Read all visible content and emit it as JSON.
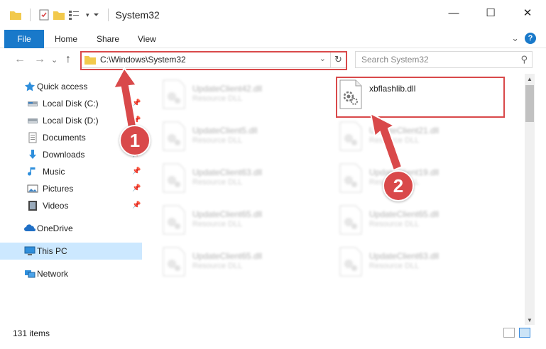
{
  "window": {
    "title": "System32",
    "minimize": "—",
    "maximize": "☐",
    "close": "✕"
  },
  "ribbon": {
    "tabs": [
      "File",
      "Home",
      "Share",
      "View"
    ],
    "expand": "⌄",
    "help": "?"
  },
  "address": {
    "back": "←",
    "forward": "→",
    "recent": "⌄",
    "up": "↑",
    "path": "C:\\Windows\\System32",
    "dropdown": "⌄",
    "refresh": "↻"
  },
  "search": {
    "placeholder": "Search System32",
    "icon": "⚲"
  },
  "sidebar": {
    "items": [
      {
        "label": "Quick access",
        "icon": "star-icon"
      },
      {
        "label": "Local Disk (C:)",
        "icon": "drive-icon",
        "pinned": true
      },
      {
        "label": "Local Disk (D:)",
        "icon": "drive-icon",
        "pinned": true
      },
      {
        "label": "Documents",
        "icon": "documents-icon",
        "pinned": true
      },
      {
        "label": "Downloads",
        "icon": "downloads-icon",
        "pinned": true
      },
      {
        "label": "Music",
        "icon": "music-icon",
        "pinned": true
      },
      {
        "label": "Pictures",
        "icon": "pictures-icon",
        "pinned": true
      },
      {
        "label": "Videos",
        "icon": "videos-icon",
        "pinned": true
      },
      {
        "label": "OneDrive",
        "icon": "onedrive-icon"
      },
      {
        "label": "This PC",
        "icon": "this-pc-icon",
        "selected": true
      },
      {
        "label": "Network",
        "icon": "network-icon"
      }
    ]
  },
  "files": [
    {
      "name": "UpdateClient42.dll",
      "type": "Resource DLL",
      "blurred": true
    },
    {
      "name": "xbflashlib.dll",
      "type": "",
      "blurred": false,
      "highlighted": true
    },
    {
      "name": "UpdateClient5.dll",
      "type": "Resource DLL",
      "blurred": true
    },
    {
      "name": "UpdateClient21.dll",
      "type": "Resource DLL",
      "blurred": true
    },
    {
      "name": "UpdateClient63.dll",
      "type": "Resource DLL",
      "blurred": true
    },
    {
      "name": "UpdateClient19.dll",
      "type": "Resource DLL",
      "blurred": true
    },
    {
      "name": "UpdateClient65.dll",
      "type": "Resource DLL",
      "blurred": true
    },
    {
      "name": "UpdateClient65.dll",
      "type": "Resource DLL",
      "blurred": true
    },
    {
      "name": "UpdateClient65.dll",
      "type": "Resource DLL",
      "blurred": true
    },
    {
      "name": "UpdateClient63.dll",
      "type": "Resource DLL",
      "blurred": true
    }
  ],
  "status": {
    "count": "131 items"
  },
  "annotations": {
    "step1": "1",
    "step2": "2",
    "color": "#d9494a"
  }
}
